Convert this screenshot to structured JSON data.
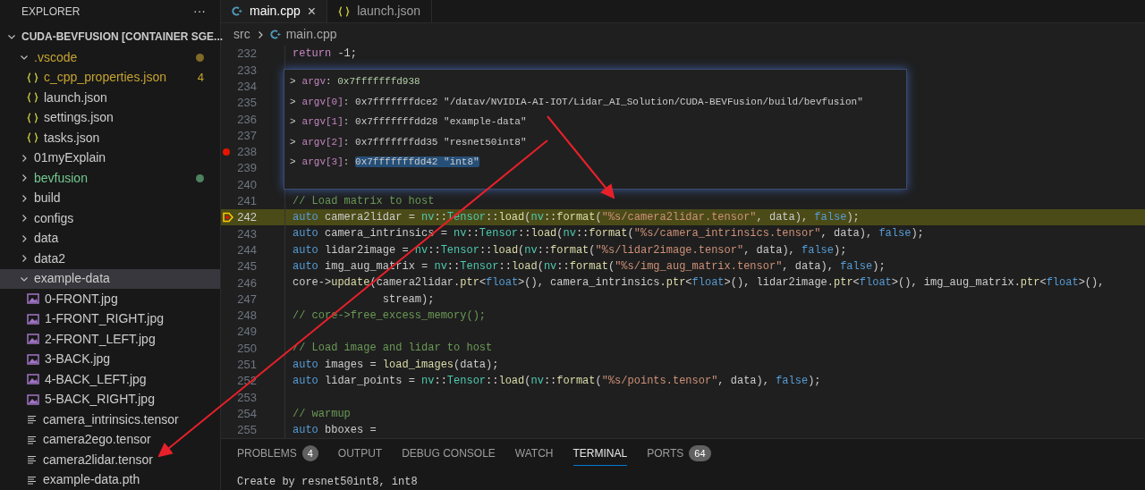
{
  "sidebar": {
    "title": "EXPLORER",
    "more": "···",
    "root": {
      "label": "CUDA-BEVFUSION [CONTAINER SGE...",
      "expanded": true
    },
    "items": [
      {
        "label": ".vscode",
        "kind": "folder",
        "expanded": true,
        "color": "#c5a332",
        "dot": true,
        "selected": false,
        "children": [
          {
            "label": "c_cpp_properties.json",
            "kind": "json",
            "color": "#c5a332",
            "badge": "4",
            "selected": false
          },
          {
            "label": "launch.json",
            "kind": "json",
            "selected": false
          },
          {
            "label": "settings.json",
            "kind": "json",
            "selected": false
          },
          {
            "label": "tasks.json",
            "kind": "json",
            "selected": false
          }
        ]
      },
      {
        "label": "01myExplain",
        "kind": "folder",
        "expanded": false,
        "selected": false
      },
      {
        "label": "bevfusion",
        "kind": "folder",
        "expanded": false,
        "color": "#73c991",
        "dot": true,
        "selected": false
      },
      {
        "label": "build",
        "kind": "folder",
        "expanded": false,
        "selected": false
      },
      {
        "label": "configs",
        "kind": "folder",
        "expanded": false,
        "selected": false
      },
      {
        "label": "data",
        "kind": "folder",
        "expanded": false,
        "selected": false
      },
      {
        "label": "data2",
        "kind": "folder",
        "expanded": false,
        "selected": false
      },
      {
        "label": "example-data",
        "kind": "folder",
        "expanded": true,
        "selected": true,
        "children": [
          {
            "label": "0-FRONT.jpg",
            "kind": "image",
            "selected": false
          },
          {
            "label": "1-FRONT_RIGHT.jpg",
            "kind": "image",
            "selected": false
          },
          {
            "label": "2-FRONT_LEFT.jpg",
            "kind": "image",
            "selected": false
          },
          {
            "label": "3-BACK.jpg",
            "kind": "image",
            "selected": false
          },
          {
            "label": "4-BACK_LEFT.jpg",
            "kind": "image",
            "selected": false
          },
          {
            "label": "5-BACK_RIGHT.jpg",
            "kind": "image",
            "selected": false
          },
          {
            "label": "camera_intrinsics.tensor",
            "kind": "file",
            "selected": false
          },
          {
            "label": "camera2ego.tensor",
            "kind": "file",
            "selected": false
          },
          {
            "label": "camera2lidar.tensor",
            "kind": "file",
            "selected": false
          },
          {
            "label": "example-data.pth",
            "kind": "file",
            "selected": false
          }
        ]
      }
    ]
  },
  "tabs": [
    {
      "label": "main.cpp",
      "kind": "cpp",
      "selected": true,
      "close": "×"
    },
    {
      "label": "launch.json",
      "kind": "json",
      "selected": false
    }
  ],
  "breadcrumb": [
    {
      "label": "src",
      "kind": "folder"
    },
    {
      "label": "main.cpp",
      "kind": "cpp"
    }
  ],
  "code": [
    {
      "number": "232",
      "breakpoint": false,
      "current": false,
      "tokens": [
        {
          "kind": "control",
          "text": "return"
        },
        {
          "kind": "plain",
          "text": " -1;"
        }
      ]
    },
    {
      "number": "233",
      "breakpoint": false,
      "current": false
    },
    {
      "number": "234",
      "breakpoint": false,
      "current": false
    },
    {
      "number": "235",
      "breakpoint": false,
      "current": false
    },
    {
      "number": "236",
      "breakpoint": false,
      "current": false
    },
    {
      "number": "237",
      "breakpoint": false,
      "current": false
    },
    {
      "number": "238",
      "breakpoint": true,
      "current": false
    },
    {
      "number": "239",
      "breakpoint": false,
      "current": false
    },
    {
      "number": "240",
      "breakpoint": false,
      "current": false
    },
    {
      "number": "241",
      "breakpoint": false,
      "current": false,
      "tokens": [
        {
          "kind": "comment",
          "text": "// Load matrix to host"
        }
      ]
    },
    {
      "number": "242",
      "breakpoint": false,
      "current": true,
      "tokens": [
        {
          "kind": "keyword",
          "text": "auto"
        },
        {
          "kind": "plain",
          "text": " camera2lidar = "
        },
        {
          "kind": "type",
          "text": "nv"
        },
        {
          "kind": "plain",
          "text": "::"
        },
        {
          "kind": "type",
          "text": "Tensor"
        },
        {
          "kind": "plain",
          "text": "::"
        },
        {
          "kind": "function",
          "text": "load"
        },
        {
          "kind": "plain",
          "text": "("
        },
        {
          "kind": "type",
          "text": "nv"
        },
        {
          "kind": "plain",
          "text": "::"
        },
        {
          "kind": "function",
          "text": "format"
        },
        {
          "kind": "plain",
          "text": "("
        },
        {
          "kind": "string",
          "text": "\"%s/camera2lidar.tensor\""
        },
        {
          "kind": "plain",
          "text": ", data), "
        },
        {
          "kind": "keyword",
          "text": "false"
        },
        {
          "kind": "plain",
          "text": ");"
        }
      ]
    },
    {
      "number": "243",
      "breakpoint": false,
      "current": false,
      "tokens": [
        {
          "kind": "keyword",
          "text": "auto"
        },
        {
          "kind": "plain",
          "text": " camera_intrinsics = "
        },
        {
          "kind": "type",
          "text": "nv"
        },
        {
          "kind": "plain",
          "text": "::"
        },
        {
          "kind": "type",
          "text": "Tensor"
        },
        {
          "kind": "plain",
          "text": "::"
        },
        {
          "kind": "function",
          "text": "load"
        },
        {
          "kind": "plain",
          "text": "("
        },
        {
          "kind": "type",
          "text": "nv"
        },
        {
          "kind": "plain",
          "text": "::"
        },
        {
          "kind": "function",
          "text": "format"
        },
        {
          "kind": "plain",
          "text": "("
        },
        {
          "kind": "string",
          "text": "\"%s/camera_intrinsics.tensor\""
        },
        {
          "kind": "plain",
          "text": ", data), "
        },
        {
          "kind": "keyword",
          "text": "false"
        },
        {
          "kind": "plain",
          "text": ");"
        }
      ]
    },
    {
      "number": "244",
      "breakpoint": false,
      "current": false,
      "tokens": [
        {
          "kind": "keyword",
          "text": "auto"
        },
        {
          "kind": "plain",
          "text": " lidar2image = "
        },
        {
          "kind": "type",
          "text": "nv"
        },
        {
          "kind": "plain",
          "text": "::"
        },
        {
          "kind": "type",
          "text": "Tensor"
        },
        {
          "kind": "plain",
          "text": "::"
        },
        {
          "kind": "function",
          "text": "load"
        },
        {
          "kind": "plain",
          "text": "("
        },
        {
          "kind": "type",
          "text": "nv"
        },
        {
          "kind": "plain",
          "text": "::"
        },
        {
          "kind": "function",
          "text": "format"
        },
        {
          "kind": "plain",
          "text": "("
        },
        {
          "kind": "string",
          "text": "\"%s/lidar2image.tensor\""
        },
        {
          "kind": "plain",
          "text": ", data), "
        },
        {
          "kind": "keyword",
          "text": "false"
        },
        {
          "kind": "plain",
          "text": ");"
        }
      ]
    },
    {
      "number": "245",
      "breakpoint": false,
      "current": false,
      "tokens": [
        {
          "kind": "keyword",
          "text": "auto"
        },
        {
          "kind": "plain",
          "text": " img_aug_matrix = "
        },
        {
          "kind": "type",
          "text": "nv"
        },
        {
          "kind": "plain",
          "text": "::"
        },
        {
          "kind": "type",
          "text": "Tensor"
        },
        {
          "kind": "plain",
          "text": "::"
        },
        {
          "kind": "function",
          "text": "load"
        },
        {
          "kind": "plain",
          "text": "("
        },
        {
          "kind": "type",
          "text": "nv"
        },
        {
          "kind": "plain",
          "text": "::"
        },
        {
          "kind": "function",
          "text": "format"
        },
        {
          "kind": "plain",
          "text": "("
        },
        {
          "kind": "string",
          "text": "\"%s/img_aug_matrix.tensor\""
        },
        {
          "kind": "plain",
          "text": ", data), "
        },
        {
          "kind": "keyword",
          "text": "false"
        },
        {
          "kind": "plain",
          "text": ");"
        }
      ]
    },
    {
      "number": "246",
      "breakpoint": false,
      "current": false,
      "tokens": [
        {
          "kind": "plain",
          "text": "core->"
        },
        {
          "kind": "function",
          "text": "update"
        },
        {
          "kind": "plain",
          "text": "(camera2lidar."
        },
        {
          "kind": "function",
          "text": "ptr"
        },
        {
          "kind": "plain",
          "text": "<"
        },
        {
          "kind": "keyword",
          "text": "float"
        },
        {
          "kind": "plain",
          "text": ">(), camera_intrinsics."
        },
        {
          "kind": "function",
          "text": "ptr"
        },
        {
          "kind": "plain",
          "text": "<"
        },
        {
          "kind": "keyword",
          "text": "float"
        },
        {
          "kind": "plain",
          "text": ">(), lidar2image."
        },
        {
          "kind": "function",
          "text": "ptr"
        },
        {
          "kind": "plain",
          "text": "<"
        },
        {
          "kind": "keyword",
          "text": "float"
        },
        {
          "kind": "plain",
          "text": ">(), img_aug_matrix."
        },
        {
          "kind": "function",
          "text": "ptr"
        },
        {
          "kind": "plain",
          "text": "<"
        },
        {
          "kind": "keyword",
          "text": "float"
        },
        {
          "kind": "plain",
          "text": ">(),"
        }
      ]
    },
    {
      "number": "247",
      "breakpoint": false,
      "current": false,
      "tokens": [
        {
          "kind": "plain",
          "text": "              stream);"
        }
      ]
    },
    {
      "number": "248",
      "breakpoint": false,
      "current": false,
      "tokens": [
        {
          "kind": "comment",
          "text": "// core->free_excess_memory();"
        }
      ]
    },
    {
      "number": "249",
      "breakpoint": false,
      "current": false
    },
    {
      "number": "250",
      "breakpoint": false,
      "current": false,
      "tokens": [
        {
          "kind": "comment",
          "text": "// Load image and lidar to host"
        }
      ]
    },
    {
      "number": "251",
      "breakpoint": false,
      "current": false,
      "tokens": [
        {
          "kind": "keyword",
          "text": "auto"
        },
        {
          "kind": "plain",
          "text": " images = "
        },
        {
          "kind": "function",
          "text": "load_images"
        },
        {
          "kind": "plain",
          "text": "(data);"
        }
      ]
    },
    {
      "number": "252",
      "breakpoint": false,
      "current": false,
      "tokens": [
        {
          "kind": "keyword",
          "text": "auto"
        },
        {
          "kind": "plain",
          "text": " lidar_points = "
        },
        {
          "kind": "type",
          "text": "nv"
        },
        {
          "kind": "plain",
          "text": "::"
        },
        {
          "kind": "type",
          "text": "Tensor"
        },
        {
          "kind": "plain",
          "text": "::"
        },
        {
          "kind": "function",
          "text": "load"
        },
        {
          "kind": "plain",
          "text": "("
        },
        {
          "kind": "type",
          "text": "nv"
        },
        {
          "kind": "plain",
          "text": "::"
        },
        {
          "kind": "function",
          "text": "format"
        },
        {
          "kind": "plain",
          "text": "("
        },
        {
          "kind": "string",
          "text": "\"%s/points.tensor\""
        },
        {
          "kind": "plain",
          "text": ", data), "
        },
        {
          "kind": "keyword",
          "text": "false"
        },
        {
          "kind": "plain",
          "text": ");"
        }
      ]
    },
    {
      "number": "253",
      "breakpoint": false,
      "current": false
    },
    {
      "number": "254",
      "breakpoint": false,
      "current": false,
      "tokens": [
        {
          "kind": "comment",
          "text": "// warmup"
        }
      ]
    },
    {
      "number": "255",
      "breakpoint": false,
      "current": false,
      "tokens": [
        {
          "kind": "keyword",
          "text": "auto"
        },
        {
          "kind": "plain",
          "text": " bboxes ="
        }
      ]
    }
  ],
  "hover": [
    {
      "expander": ">",
      "name": "argv",
      "separator": ":",
      "value": "0x7fffffffd938",
      "kind": "pointer",
      "selected": false
    },
    {
      "expander": ">",
      "name": "argv[0]",
      "separator": ":",
      "value": "0x7fffffffdce2 \"/datav/NVIDIA-AI-IOT/Lidar_AI_Solution/CUDA-BEVFusion/build/bevfusion\"",
      "kind": "string",
      "selected": false
    },
    {
      "expander": ">",
      "name": "argv[1]",
      "separator": ":",
      "value": "0x7fffffffdd28 \"example-data\"",
      "kind": "string",
      "selected": false
    },
    {
      "expander": ">",
      "name": "argv[2]",
      "separator": ":",
      "value": "0x7fffffffdd35 \"resnet50int8\"",
      "kind": "string",
      "selected": false
    },
    {
      "expander": ">",
      "name": "argv[3]",
      "separator": ":",
      "value": "0x7fffffffdd42 \"int8\"",
      "kind": "string",
      "selected": true
    }
  ],
  "panel": {
    "tabs": [
      {
        "label": "PROBLEMS",
        "badge": "4",
        "selected": false
      },
      {
        "label": "OUTPUT",
        "selected": false
      },
      {
        "label": "DEBUG CONSOLE",
        "selected": false
      },
      {
        "label": "WATCH",
        "selected": false
      },
      {
        "label": "TERMINAL",
        "selected": true
      },
      {
        "label": "PORTS",
        "badge": "64",
        "selected": false
      }
    ],
    "terminal": [
      "Create by resnet50int8, int8"
    ]
  }
}
